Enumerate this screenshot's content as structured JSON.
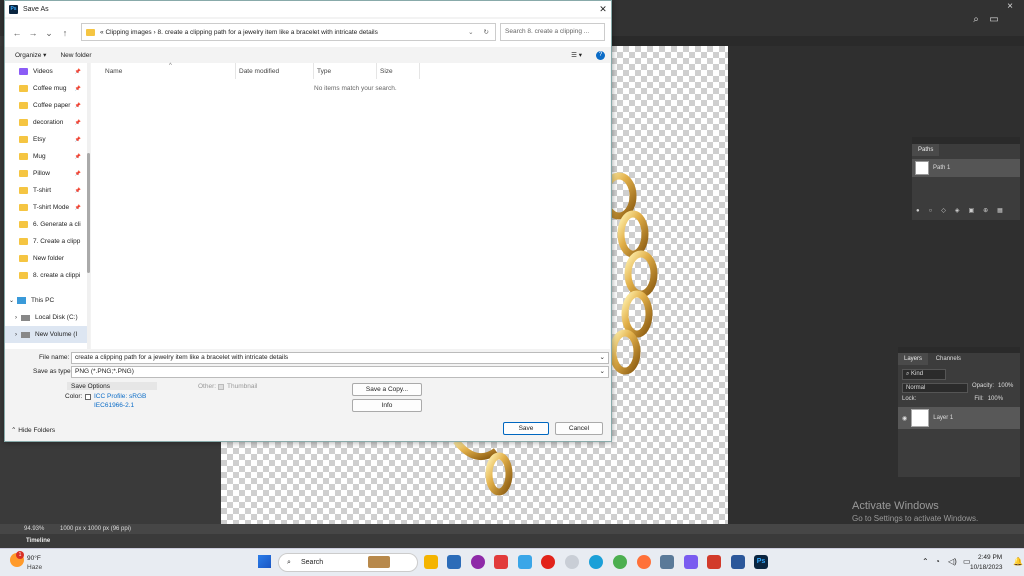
{
  "photoshop": {
    "status_zoom": "94.93%",
    "status_doc": "1000 px x 1000 px (96 ppi)",
    "timeline_label": "Timeline",
    "paths_panel": {
      "tab": "Paths",
      "item": "Path 1"
    },
    "layers_panel": {
      "tabs": [
        "Layers",
        "Channels"
      ],
      "kind": "Kind",
      "blend_mode": "Normal",
      "opacity_label": "Opacity:",
      "opacity_value": "100%",
      "lock_label": "Lock:",
      "fill_label": "Fill:",
      "fill_value": "100%",
      "layer_name": "Layer 1"
    },
    "watermark": {
      "line1": "Activate Windows",
      "line2": "Go to Settings to activate Windows."
    }
  },
  "dialog": {
    "title": "Save As",
    "breadcrumb": [
      "«",
      "Clipping images",
      "›",
      "8. create a clipping path for a jewelry item like a bracelet with intricate details"
    ],
    "search_placeholder": "Search 8. create a clipping ...",
    "organize": "Organize",
    "new_folder": "New folder",
    "nav_items": [
      "Videos",
      "Coffee mug",
      "Coffee paper",
      "decoration",
      "Etsy",
      "Mug",
      "Pillow",
      "T-shirt",
      "T-shirt Mode",
      "6. Generate a cli",
      "7. Create a clipp",
      "New folder",
      "8. create a clippi"
    ],
    "this_pc": "This PC",
    "drives": [
      "Local Disk (C:)",
      "New Volume (I"
    ],
    "columns": [
      "Name",
      "Date modified",
      "Type",
      "Size"
    ],
    "empty_text": "No items match your search.",
    "file_name_label": "File name:",
    "file_name": "create a clipping path for a jewelry item like a bracelet with intricate details",
    "save_type_label": "Save as type:",
    "save_type": "PNG (*.PNG;*.PNG)",
    "save_options": "Save Options",
    "color_label": "Color:",
    "icc_label": "ICC Profile:  sRGB",
    "icc_sub": "IEC61966-2.1",
    "other_label": "Other:",
    "thumbnail": "Thumbnail",
    "save_copy": "Save a Copy...",
    "info": "Info",
    "hide_folders": "Hide Folders",
    "save": "Save",
    "cancel": "Cancel"
  },
  "taskbar": {
    "weather_temp": "90°F",
    "weather_desc": "Haze",
    "weather_badge": "1",
    "search": "Search",
    "time": "2:49 PM",
    "date": "10/18/2023"
  }
}
